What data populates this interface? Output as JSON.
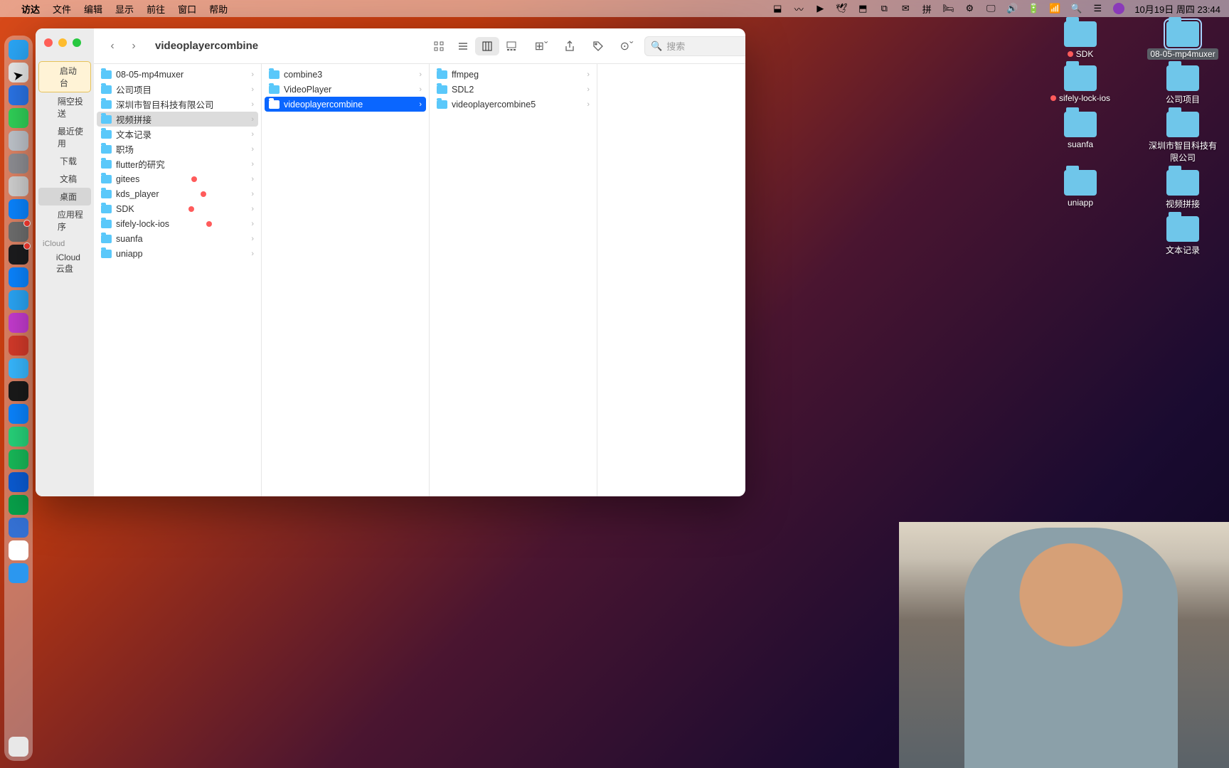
{
  "menubar": {
    "app": "访达",
    "items": [
      "文件",
      "编辑",
      "显示",
      "前往",
      "窗口",
      "帮助"
    ],
    "datetime": "10月19日 周四  23:44"
  },
  "sidebar": {
    "items": [
      {
        "label": "启动台",
        "highlighted": true
      },
      {
        "label": "隔空投送"
      },
      {
        "label": "最近使用"
      },
      {
        "label": "下载"
      },
      {
        "label": "文稿"
      },
      {
        "label": "桌面",
        "selected": true
      },
      {
        "label": "应用程序"
      }
    ],
    "icloud_heading": "iCloud",
    "icloud_items": [
      {
        "label": "iCloud 云盘"
      }
    ]
  },
  "finder": {
    "title": "videoplayercombine",
    "search_placeholder": "搜索"
  },
  "columns": [
    [
      {
        "name": "08-05-mp4muxer",
        "chevron": true
      },
      {
        "name": "公司项目",
        "chevron": true
      },
      {
        "name": "深圳市智目科技有限公司",
        "chevron": true
      },
      {
        "name": "视频拼接",
        "chevron": true,
        "selected_grey": true
      },
      {
        "name": "文本记录",
        "chevron": true
      },
      {
        "name": "职场",
        "chevron": true
      },
      {
        "name": "flutter的研究",
        "chevron": true
      },
      {
        "name": "gitees",
        "reddot": true,
        "chevron": true
      },
      {
        "name": "kds_player",
        "reddot": true,
        "chevron": true
      },
      {
        "name": "SDK",
        "reddot": true,
        "chevron": true
      },
      {
        "name": "sifely-lock-ios",
        "reddot": true,
        "chevron": true
      },
      {
        "name": "suanfa",
        "chevron": true
      },
      {
        "name": "uniapp",
        "chevron": true
      }
    ],
    [
      {
        "name": "combine3",
        "chevron": true
      },
      {
        "name": "VideoPlayer",
        "chevron": true
      },
      {
        "name": "videoplayercombine",
        "chevron": true,
        "selected_blue": true
      }
    ],
    [
      {
        "name": "ffmpeg",
        "chevron": true
      },
      {
        "name": "SDL2",
        "chevron": true
      },
      {
        "name": "videoplayercombine5",
        "chevron": true
      }
    ]
  ],
  "desktop": [
    [
      {
        "label": "SDK",
        "reddot": true
      },
      {
        "label": "08-05-mp4muxer",
        "selected": true
      }
    ],
    [
      {
        "label": "sifely-lock-ios",
        "reddot": true
      },
      {
        "label": "公司项目"
      }
    ],
    [
      {
        "label": "suanfa"
      },
      {
        "label": "深圳市智目科技有限公司"
      }
    ],
    [
      {
        "label": "uniapp"
      },
      {
        "label": "视频拼接"
      }
    ],
    [
      {
        "label": ""
      },
      {
        "label": "文本记录"
      }
    ]
  ],
  "dock_colors": [
    "#2aa5f5",
    "#e8e8e8",
    "#2a74e6",
    "#30d158",
    "#bfc4cb",
    "#8e8e93",
    "#d0d0d0",
    "#0a84ff",
    "#6e6e6e",
    "#1c1c1e",
    "#0a84ff",
    "#2aa5f5",
    "#c43bcf",
    "#d43a2a",
    "#37b8ff",
    "#1a1a1a",
    "#0a84ff",
    "#27d37a",
    "#18ba59",
    "#0a5bd3",
    "#08a04a",
    "#3571d4",
    "#ffffff",
    "#2b97ef"
  ]
}
